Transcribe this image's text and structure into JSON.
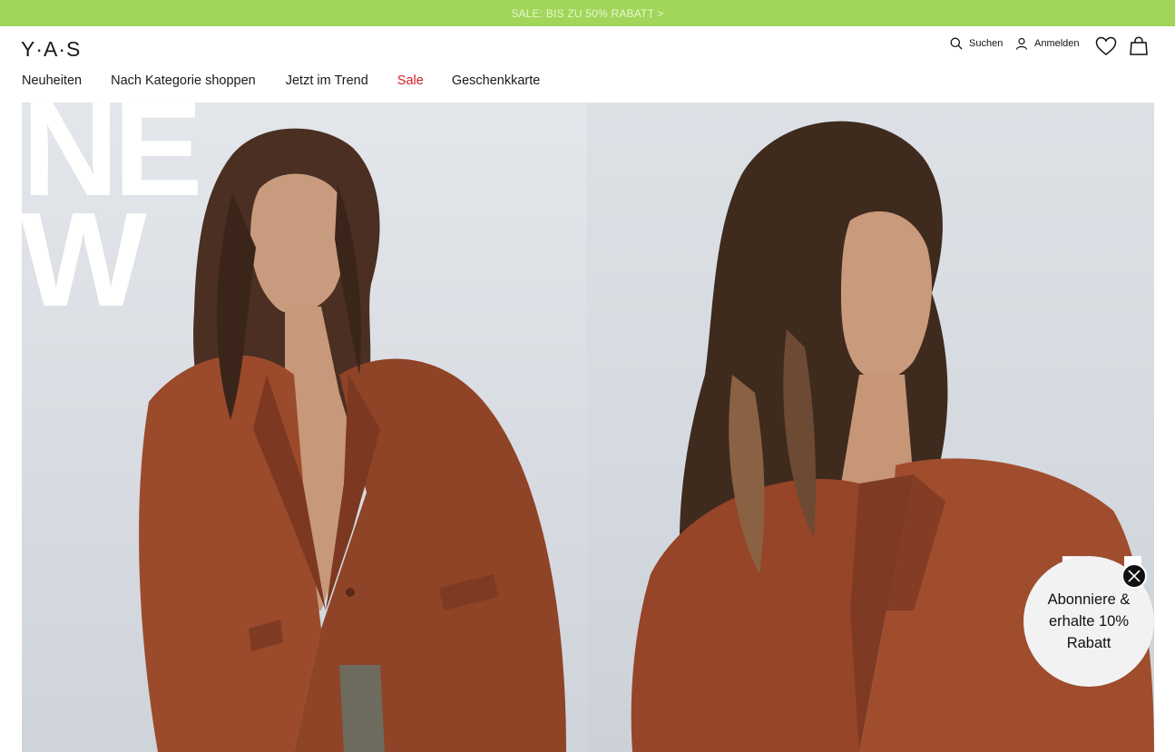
{
  "promo": {
    "text": "SALE: BIS ZU 50% RABATT >"
  },
  "header": {
    "logo": "Y·A·S",
    "search_label": "Suchen",
    "login_label": "Anmelden",
    "wishlist_icon": "heart-icon",
    "bag_icon": "shopping-bag-icon"
  },
  "nav": {
    "items": [
      {
        "label": "Neuheiten"
      },
      {
        "label": "Nach Kategorie shoppen"
      },
      {
        "label": "Jetzt im Trend"
      },
      {
        "label": "Sale",
        "color": "#d41f25"
      },
      {
        "label": "Geschenkkarte"
      }
    ]
  },
  "hero": {
    "overlay_letters_left": [
      "NE",
      "W"
    ],
    "overlay_letters_right": [
      "N"
    ]
  },
  "popup": {
    "line1": "Abonniere &",
    "line2": "erhalte 10% Rabatt",
    "close_icon": "close-icon"
  },
  "colors": {
    "promo_bg": "#a1d65a",
    "sale_red": "#d41f25",
    "jacket": "#9b4a2c"
  }
}
